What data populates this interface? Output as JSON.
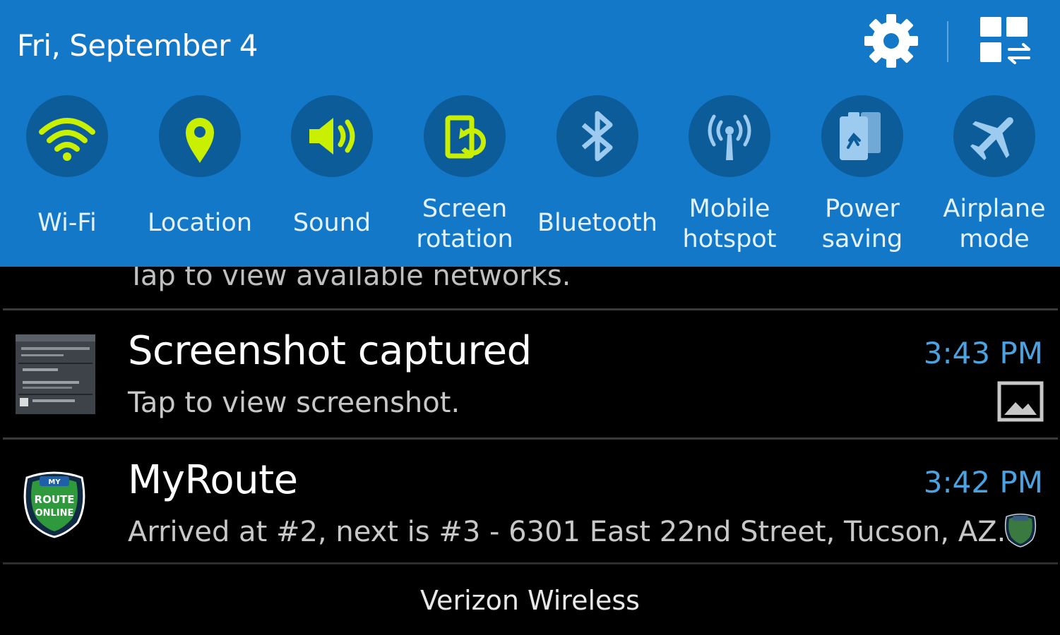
{
  "header": {
    "date": "Fri, September 4",
    "settings_icon": "gear-icon",
    "edit_icon": "grid-edit-icon"
  },
  "quick_settings": [
    {
      "label": "Wi-Fi",
      "icon": "wifi-icon",
      "active": true
    },
    {
      "label": "Location",
      "icon": "location-pin-icon",
      "active": true
    },
    {
      "label": "Sound",
      "icon": "speaker-icon",
      "active": true
    },
    {
      "label": "Screen\nrotation",
      "icon": "screen-rotation-icon",
      "active": true
    },
    {
      "label": "Bluetooth",
      "icon": "bluetooth-icon",
      "active": false
    },
    {
      "label": "Mobile\nhotspot",
      "icon": "hotspot-icon",
      "active": false
    },
    {
      "label": "Power\nsaving",
      "icon": "power-saving-icon",
      "active": false
    },
    {
      "label": "Airplane\nmode",
      "icon": "airplane-icon",
      "active": false
    }
  ],
  "notifications": {
    "partial_text": "Tap to view available networks.",
    "items": [
      {
        "title": "Screenshot captured",
        "subtitle": "Tap to view screenshot.",
        "time": "3:43 PM",
        "icon": "screenshot-thumbnail"
      },
      {
        "title": "MyRoute",
        "subtitle": "Arrived at #2, next is #3 - 6301 East 22nd Street, Tucson, AZ..",
        "time": "3:42 PM",
        "icon": "myroute-logo",
        "logo_text": [
          "MY",
          "ROUTE",
          "ONLINE"
        ]
      }
    ]
  },
  "footer": {
    "carrier": "Verizon Wireless"
  },
  "colors": {
    "panel_bg": "#1478c8",
    "tile_circle": "#0d5c9a",
    "active_icon": "#c8f000",
    "inactive_icon": "#9ccbef",
    "time_text": "#4aa3e0"
  }
}
